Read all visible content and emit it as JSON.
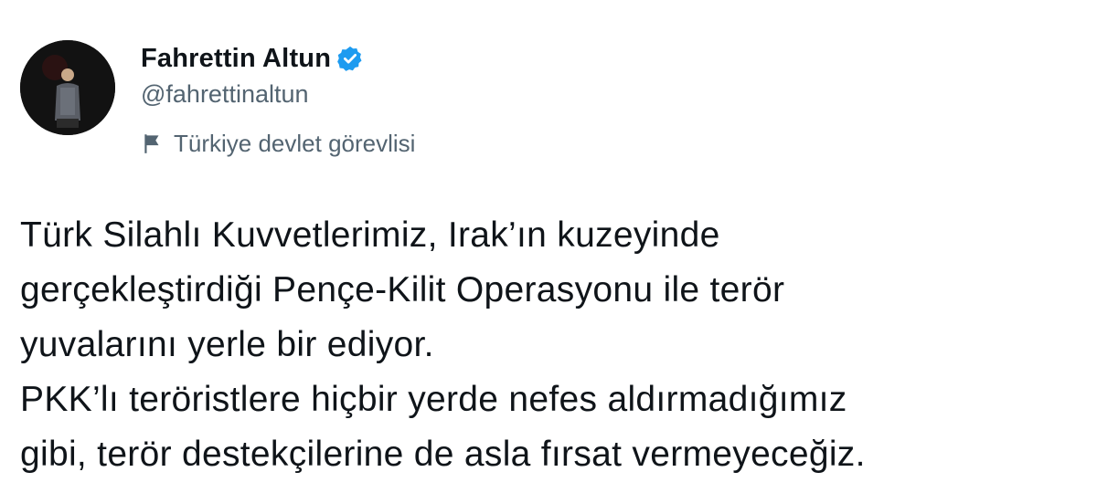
{
  "author": {
    "display_name": "Fahrettin Altun",
    "handle": "@fahrettinaltun",
    "verified": true,
    "verified_color": "#1d9bf0",
    "avatar_icon": "profile-photo"
  },
  "label": {
    "icon": "flag-icon",
    "text": "Türkiye devlet görevlisi"
  },
  "tweet": {
    "lines": [
      "Türk Silahlı Kuvvetlerimiz, Irak’ın kuzeyinde",
      "gerçekleştirdiği Pençe-Kilit Operasyonu ile terör",
      "yuvalarını yerle bir ediyor.",
      "PKK’lı teröristlere hiçbir yerde nefes aldırmadığımız",
      "gibi, terör destekçilerine de asla fırsat vermeyeceğiz."
    ]
  },
  "colors": {
    "text_primary": "#0f1419",
    "text_secondary": "#536471",
    "background": "#ffffff"
  }
}
